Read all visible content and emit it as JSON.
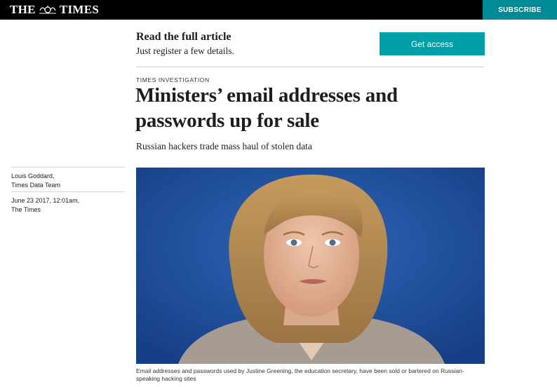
{
  "header": {
    "logo_left": "THE",
    "logo_right": "TIMES",
    "subscribe_label": "SUBSCRIBE"
  },
  "registration": {
    "title": "Read the full article",
    "subtitle": "Just register a few details.",
    "cta_label": "Get access"
  },
  "article": {
    "kicker": "TIMES INVESTIGATION",
    "headline_line1": "Ministers’ email addresses and",
    "headline_line2": "passwords up for sale",
    "standfirst": "Russian hackers trade mass haul of stolen data",
    "author_name": "Louis Goddard,",
    "author_team": "Times Data Team",
    "date": "June 23 2017, 12:01am,",
    "publication": "The Times",
    "image_caption_line1": "Email addresses and passwords used by Justine Greening, the education secretary, have been sold or bartered on Russian-",
    "image_caption_line2": "speaking hacking sites"
  },
  "colors": {
    "topbar": "#000000",
    "subscribe": "#008a95",
    "get_access": "#00a0a8",
    "photo_bg": "#1e4f9a"
  }
}
